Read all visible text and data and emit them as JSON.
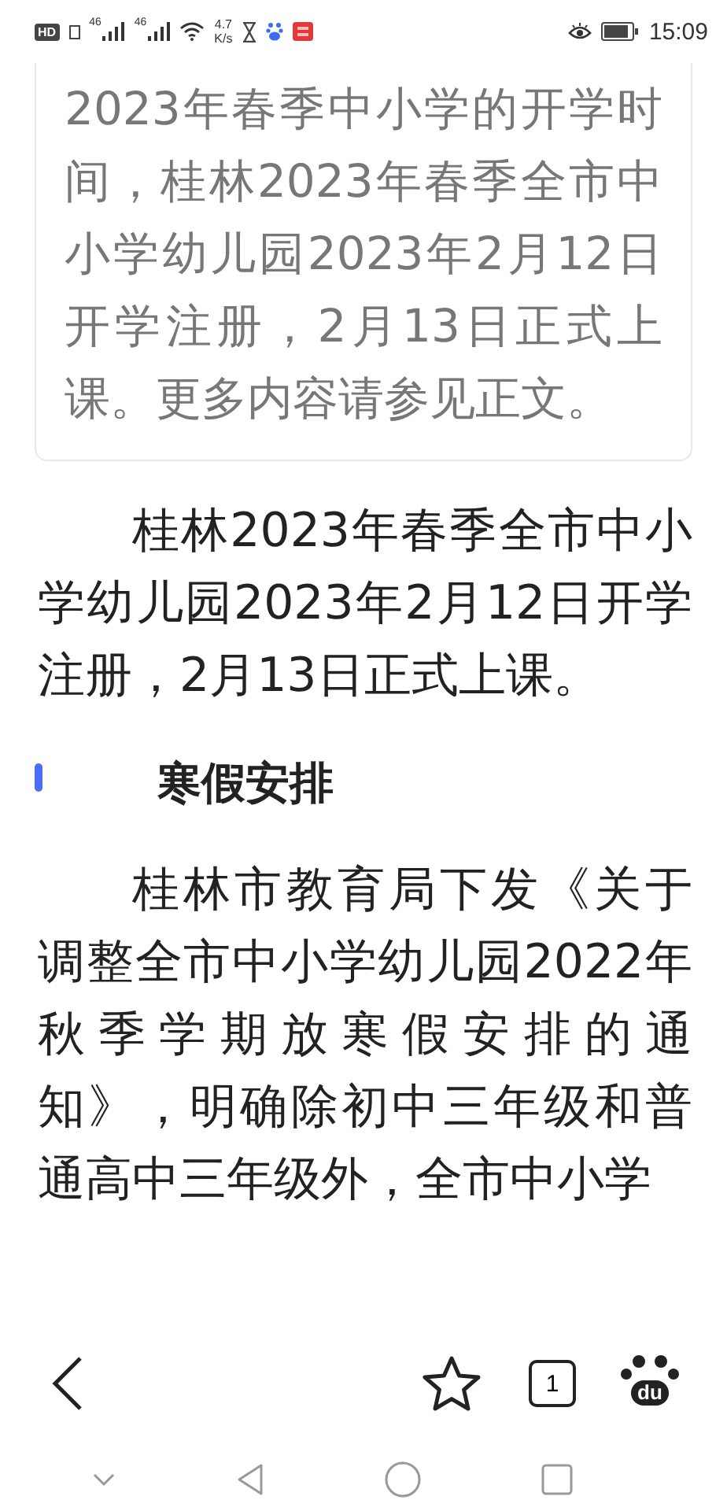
{
  "status_bar": {
    "hd": "HD",
    "networks": [
      "46",
      "46"
    ],
    "speed": "4.7",
    "speed_unit": "K/s",
    "time": "15:09"
  },
  "summary": {
    "text": "2023年春季中小学的开学时间，桂林2023年春季全市中小学幼儿园2023年2月12日开学注册，2月13日正式上课。更多内容请参见正文。"
  },
  "article": [
    {
      "kind": "paragraph",
      "text": "桂林2023年春季全市中小学幼儿园2023年2月12日开学注册，2月13日正式上课。"
    },
    {
      "kind": "heading",
      "text": "寒假安排"
    },
    {
      "kind": "paragraph",
      "text": "桂林市教育局下发《关于调整全市中小学幼儿园2022年秋季学期放寒假安排的通知》，明确除初中三年级和普通高中三年级外，全市中小学"
    }
  ],
  "toolbar": {
    "tab_count": "1",
    "logo_text": "du"
  }
}
